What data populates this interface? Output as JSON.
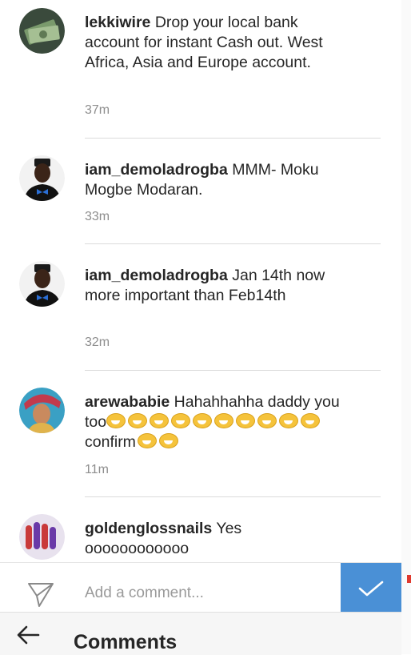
{
  "comments": [
    {
      "username": "lekkiwire",
      "text": "Drop your local bank account for instant Cash out. West Africa, Asia and Europe account.",
      "time": "37m",
      "avatar": "money-avatar"
    },
    {
      "username": "iam_demoladrogba",
      "text": "MMM- Moku Mogbe Modaran.",
      "time": "33m",
      "avatar": "man-bowtie-avatar"
    },
    {
      "username": "iam_demoladrogba",
      "text": "Jan 14th now more important than Feb14th",
      "time": "32m",
      "avatar": "man-bowtie-avatar"
    },
    {
      "username": "arewababie",
      "text_before": "Hahahhahha daddy you too",
      "text_middle": "confirm",
      "time": "11m",
      "avatar": "woman-avatar",
      "emoji": "grinning-squinting-face"
    },
    {
      "username": "goldenglossnails",
      "text": "Yes oooooooooooo",
      "avatar": "nails-avatar"
    }
  ],
  "input": {
    "placeholder": "Add a comment..."
  },
  "header": {
    "title": "Comments"
  },
  "icons": {
    "send": "paper-plane-icon",
    "post": "checkmark-icon",
    "back": "back-arrow-icon"
  },
  "colors": {
    "post_button": "#4a90d6",
    "timestamp": "#8e8e8e",
    "text": "#262626"
  }
}
